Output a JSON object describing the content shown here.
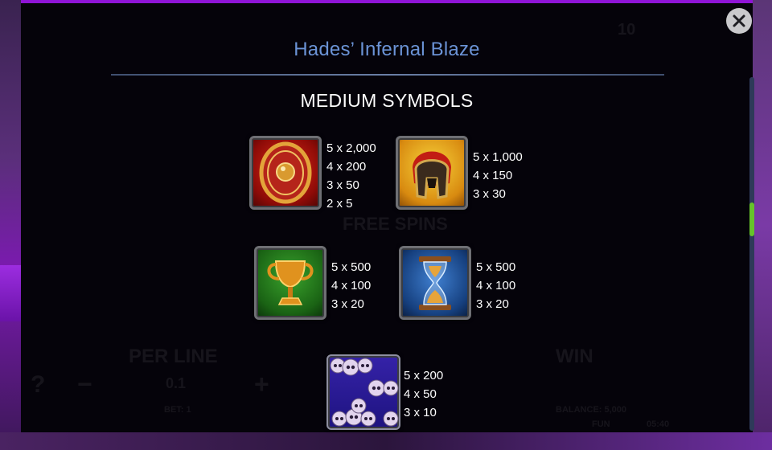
{
  "modal": {
    "title": "Hades’ Infernal Blaze",
    "section_title": "MEDIUM SYMBOLS"
  },
  "symbols": [
    {
      "name": "shield",
      "icon": "shield-icon",
      "pays": [
        "5 x 2,000",
        "4 x 200",
        "3 x 50",
        "2 x 5"
      ]
    },
    {
      "name": "helmet",
      "icon": "spartan-helmet-icon",
      "pays": [
        "5 x 1,000",
        "4 x 150",
        "3 x 30"
      ]
    },
    {
      "name": "goblet",
      "icon": "golden-cup-icon",
      "pays": [
        "5 x 500",
        "4 x 100",
        "3 x 20"
      ]
    },
    {
      "name": "hourglass",
      "icon": "hourglass-icon",
      "pays": [
        "5 x 500",
        "4 x 100",
        "3 x 20"
      ]
    },
    {
      "name": "skulls",
      "icon": "skull-pile-icon",
      "pays": [
        "5 x 200",
        "4 x 50",
        "3 x 10"
      ]
    }
  ],
  "background": {
    "per_line_label": "PER LINE",
    "per_line_value": "0.1",
    "win_label": "WIN",
    "bet_label": "BET: 1",
    "balance_label": "BALANCE: 5,000",
    "fun_label": "FUN",
    "time": "05:40",
    "free_spins": "FREE SPINS",
    "help": "?",
    "minus": "−",
    "plus": "+",
    "lines_count": "10"
  },
  "colors": {
    "title": "#6b93d6",
    "scroll_thumb": "#66c22a",
    "accent_purple": "#8f14d6"
  }
}
